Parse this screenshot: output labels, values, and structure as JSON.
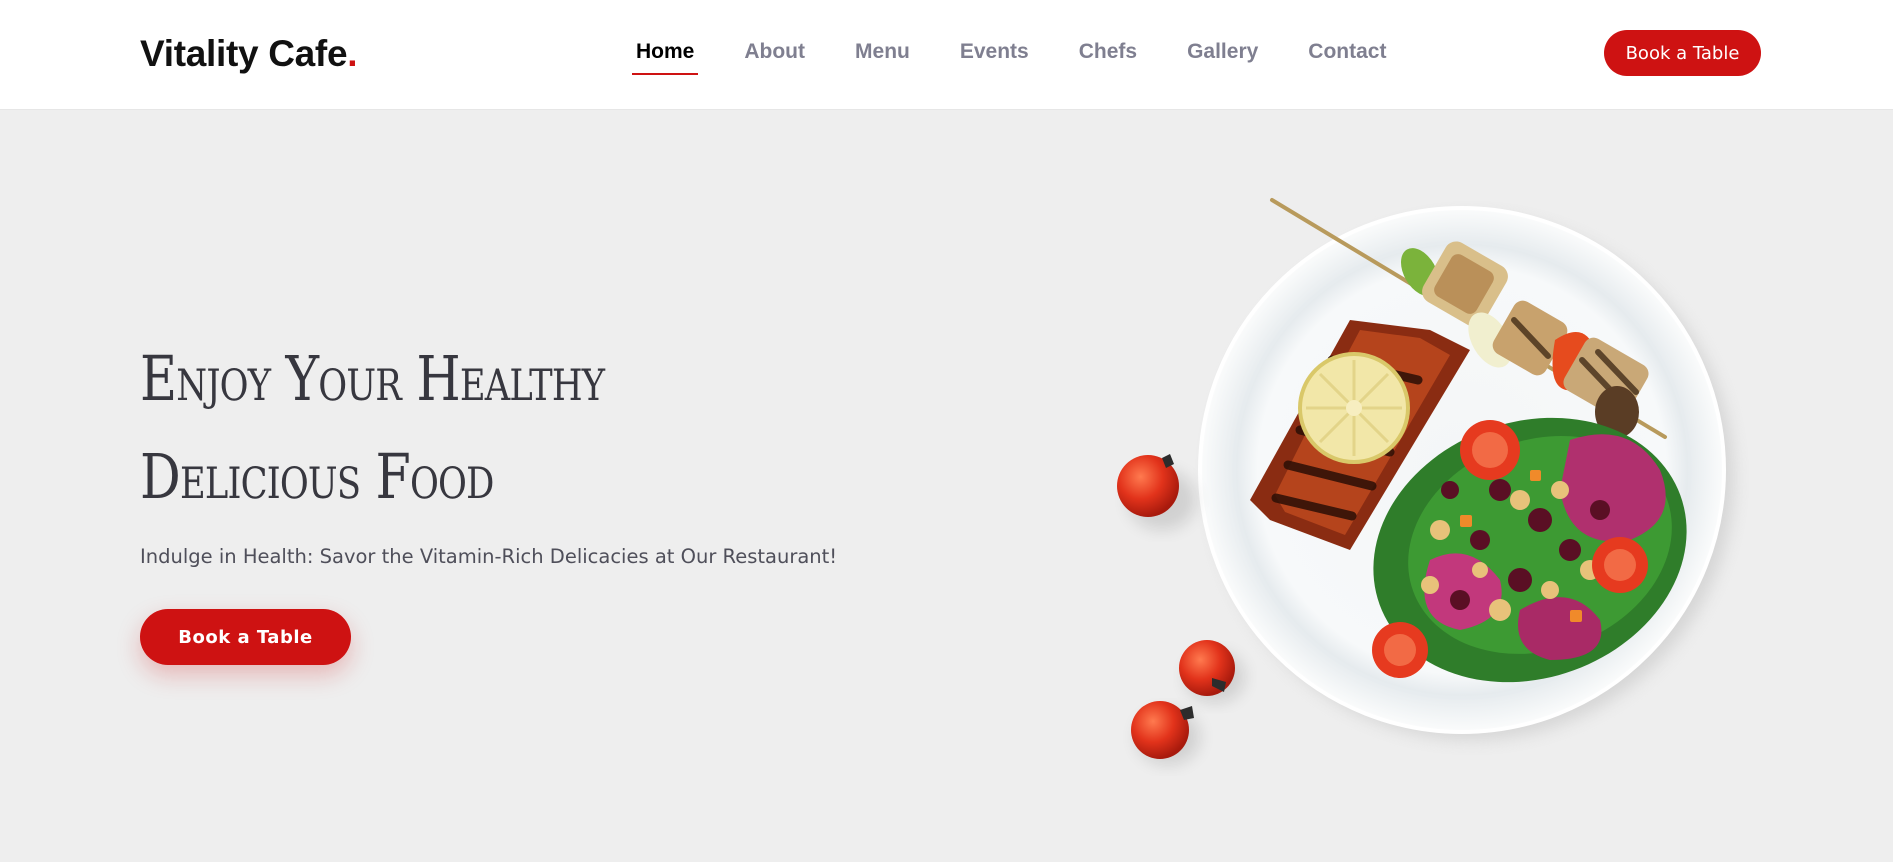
{
  "header": {
    "logo_text": "Vitality Cafe",
    "logo_dot": ".",
    "nav": [
      {
        "label": "Home",
        "active": true
      },
      {
        "label": "About"
      },
      {
        "label": "Menu"
      },
      {
        "label": "Events"
      },
      {
        "label": "Chefs"
      },
      {
        "label": "Gallery"
      },
      {
        "label": "Contact"
      }
    ],
    "cta_label": "Book a Table"
  },
  "hero": {
    "title_line1": "Enjoy Your Healthy",
    "title_line2": "Delicious Food",
    "subtitle": "Indulge in Health: Savor the Vitamin-Rich Delicacies at Our Restaurant!",
    "cta_label": "Book a Table"
  },
  "colors": {
    "accent": "#ce1212",
    "background": "#eeeeee",
    "header_bg": "#ffffff",
    "title": "#37373f",
    "nav_inactive": "#7f7f90"
  },
  "icons": {
    "hero_image": "salmon-salad-plate-illustration",
    "tomatoes": "cherry-tomato-icon"
  }
}
